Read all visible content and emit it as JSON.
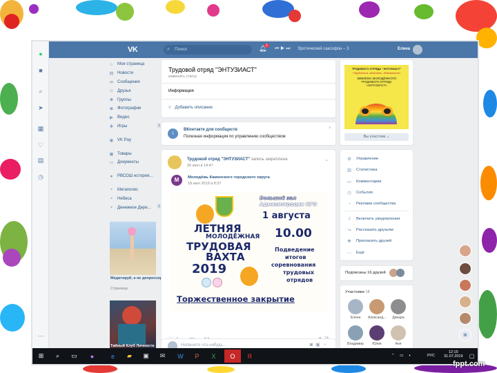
{
  "header": {
    "search_placeholder": "Поиск",
    "notif_count": "1",
    "track": "Эротический саксофон – 3",
    "user_name": "Елена"
  },
  "left_menu": {
    "items": [
      {
        "label": "Моя страница",
        "icon": "home-icon"
      },
      {
        "label": "Новости",
        "icon": "news-icon"
      },
      {
        "label": "Сообщения",
        "icon": "messages-icon"
      },
      {
        "label": "Друзья",
        "icon": "friends-icon"
      },
      {
        "label": "Группы",
        "icon": "groups-icon"
      },
      {
        "label": "Фотографии",
        "icon": "photos-icon"
      },
      {
        "label": "Видео",
        "icon": "video-icon"
      },
      {
        "label": "Игры",
        "icon": "games-icon",
        "count": "1"
      }
    ],
    "items2": [
      {
        "label": "VK Pay",
        "icon": "vkpay-icon"
      }
    ],
    "items3": [
      {
        "label": "Товары",
        "icon": "goods-icon"
      },
      {
        "label": "Документы",
        "icon": "documents-icon"
      }
    ],
    "items4": [
      {
        "label": "РВСОШ история...",
        "icon": "group-icon"
      }
    ],
    "items5": [
      {
        "label": "Мегаполис",
        "icon": "app-icon"
      },
      {
        "label": "Небеса",
        "icon": "app-icon"
      },
      {
        "label": "Денежное Дере...",
        "icon": "app-icon",
        "count": "1"
      }
    ],
    "ad1_title": "Медитируй, а не депрессируй!",
    "ad1_sub": "Страница",
    "ad2_title": "Тайный Клуб Личности"
  },
  "group_card": {
    "title": "Трудовой отряд \"ЭНТУЗИАСТ\"",
    "status_hint": "изменить статус",
    "info_label": "Информация",
    "add_desc": "Добавить описание"
  },
  "promo": {
    "title": "ВКонтакте для сообществ",
    "text": "Полезная информация по управлению сообществом"
  },
  "post": {
    "author": "Трудовой отряд \"ЭНТУЗИАСТ\"",
    "pinned": "запись закреплена",
    "date": "26 июл в 14:47",
    "repost_author": "Молодёжь Каменского городского округа",
    "repost_date": "18 июл 2019 в 8:37",
    "likes": "3",
    "views": "14",
    "comment_placeholder": "Напишите что-нибудь..."
  },
  "poster": {
    "top1": "Большой зал",
    "top2": "Администрации КГО",
    "date": "1 августа",
    "time": "10.00",
    "line1": "ЛЕТНЯЯ",
    "line2": "МОЛОДЁЖНАЯ",
    "line3": "ТРУДОВАЯ",
    "line4": "ВАХТА",
    "year": "2019",
    "right1": "Подведение",
    "right2": "итогов",
    "right3": "соревнования",
    "right4": "трудовых",
    "right5": "отрядов",
    "bottom": "Торжественное закрытие"
  },
  "cover": {
    "l1": "ТРУДОВОГО ОТРЯДА \"ЭНТУЗИАСТ\"",
    "l2": "«Трудиться, мечтать, добиваться»",
    "l3": "ЭМБЛЕМА МОЛОДЁЖНОГО",
    "l4": "ТРУДОВОГО ОТРЯДА",
    "l5": "«ЭНТУЗИАСТ»",
    "member_btn": "Вы участник"
  },
  "actions": [
    {
      "label": "Управление",
      "icon": "settings-icon"
    },
    {
      "label": "Статистика",
      "icon": "stats-icon"
    },
    {
      "label": "Комментарии",
      "icon": "comments-icon"
    },
    {
      "label": "События",
      "icon": "events-icon"
    },
    {
      "label": "Реклама сообщества",
      "icon": "ads-icon"
    },
    {
      "label": "Включить уведомления",
      "icon": "bell-icon"
    },
    {
      "label": "Рассказать друзьям",
      "icon": "share-icon"
    },
    {
      "label": "Пригласить друзей",
      "icon": "invite-icon"
    },
    {
      "label": "Ещё",
      "icon": "more-icon"
    }
  ],
  "subs": {
    "label": "Подписаны 16 друзей"
  },
  "members": {
    "label": "Участники",
    "count": "18",
    "names": [
      "Елена",
      "Александ...",
      "Динара",
      "Владимир",
      "Юлия",
      "Аня"
    ]
  },
  "taskbar": {
    "lang": "РУС",
    "time": "12:15",
    "date": "31.07.2019"
  },
  "watermark": "fppt.com"
}
